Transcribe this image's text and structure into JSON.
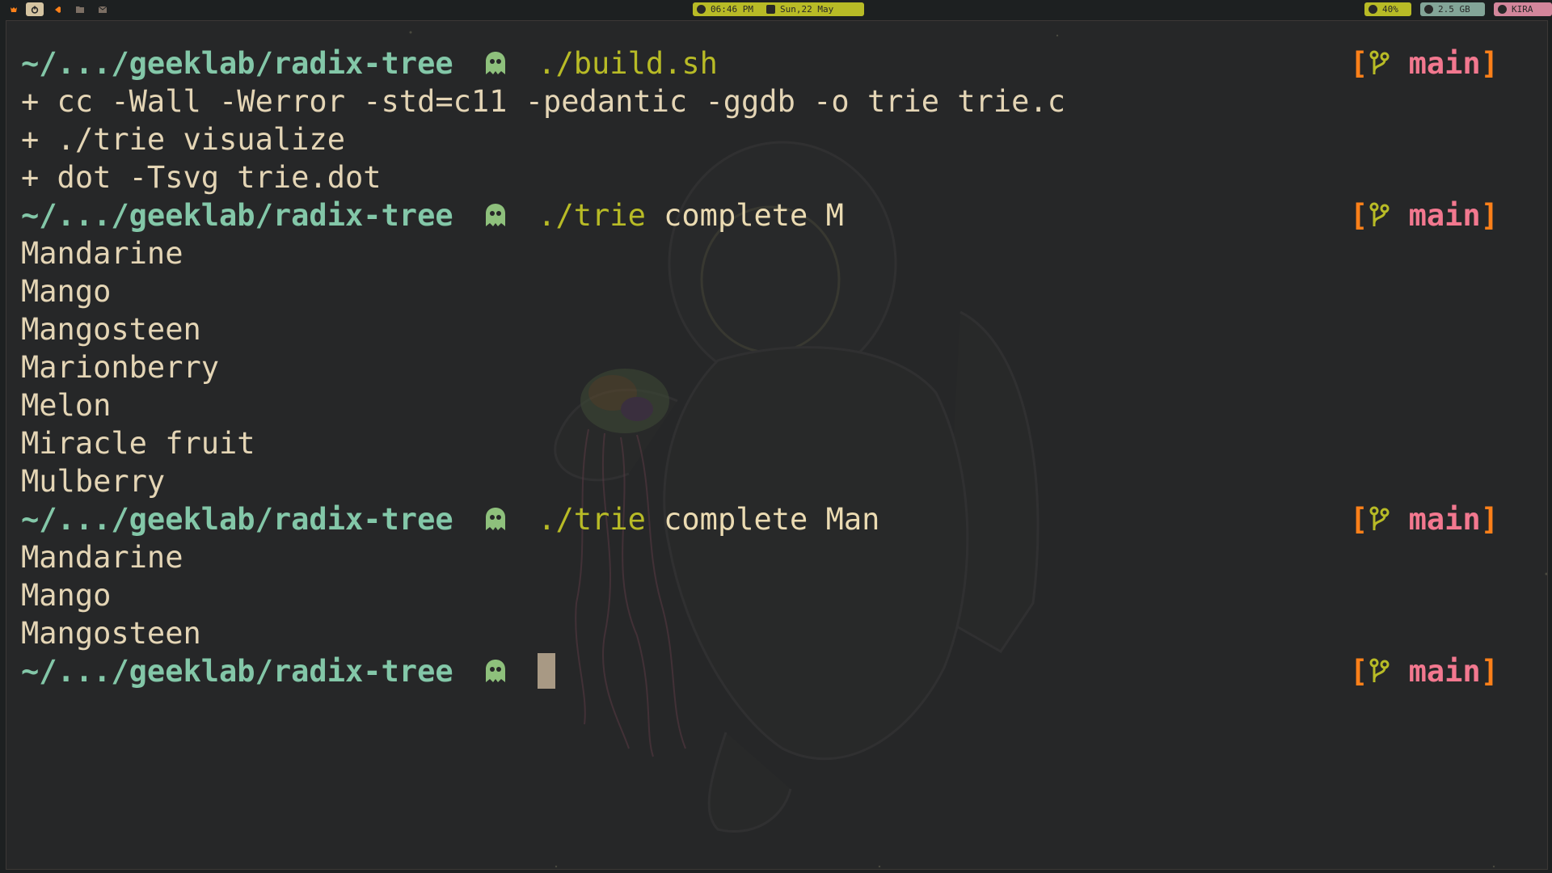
{
  "topbar": {
    "workspaces": [
      {
        "icon": "firefox-icon"
      },
      {
        "icon": "power-icon",
        "active": true
      },
      {
        "icon": "vscode-icon"
      },
      {
        "icon": "folder-icon"
      },
      {
        "icon": "mail-icon"
      }
    ],
    "time": "06:46 PM",
    "date": "Sun,22 May",
    "volume": "40%",
    "memory": "2.5 GB",
    "user": "KIRA",
    "colors": {
      "green": "#b8bb26",
      "blue": "#83a598",
      "pink": "#d3869b"
    }
  },
  "terminal": {
    "prompt_path": "~/.../geeklab/radix-tree",
    "prompt_glyph": "ghost-icon",
    "branch": {
      "open": "[",
      "icon": "git-branch-icon",
      "name": "main",
      "close": "]"
    },
    "colors": {
      "path": "#83c7a8",
      "command": "#b8bb26",
      "text": "#e4d5b5",
      "branch_bracket": "#fe8019",
      "branch_name": "#f2788f"
    },
    "blocks": [
      {
        "command": "./build.sh",
        "args": "",
        "output": [
          "+ cc -Wall -Werror -std=c11 -pedantic -ggdb -o trie trie.c",
          "+ ./trie visualize",
          "+ dot -Tsvg trie.dot"
        ]
      },
      {
        "command": "./trie",
        "args": "complete M",
        "output": [
          "Mandarine",
          "Mango",
          "Mangosteen",
          "Marionberry",
          "Melon",
          "Miracle fruit",
          "Mulberry"
        ]
      },
      {
        "command": "./trie",
        "args": "complete Man",
        "output": [
          "Mandarine",
          "Mango",
          "Mangosteen"
        ]
      },
      {
        "command": "",
        "args": "",
        "output": []
      }
    ]
  }
}
